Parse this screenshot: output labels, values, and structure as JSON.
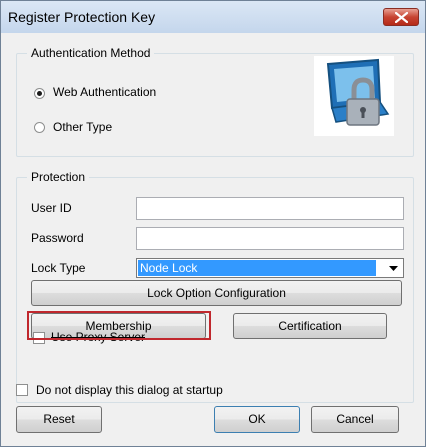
{
  "window": {
    "title": "Register Protection Key",
    "close_label": "close"
  },
  "auth": {
    "legend": "Authentication Method",
    "web_label": "Web Authentication",
    "other_label": "Other Type",
    "selected": "Web Authentication"
  },
  "protection": {
    "legend": "Protection",
    "user_id_label": "User ID",
    "user_id_value": "",
    "password_label": "Password",
    "password_value": "",
    "lock_type_label": "Lock Type",
    "lock_type_value": "Node Lock",
    "lock_option_button": "Lock Option Configuration",
    "membership_button": "Membership",
    "certification_button": "Certification",
    "proxy_label": "Use Proxy Server"
  },
  "footer": {
    "startup_label": "Do not display this dialog at startup",
    "reset_button": "Reset",
    "ok_button": "OK",
    "cancel_button": "Cancel"
  },
  "colors": {
    "highlight": "#c0272d",
    "selection": "#3399ff",
    "close": "#c74432"
  },
  "icons": {
    "logo": "laptop-lock-icon",
    "close": "close-icon",
    "dropdown": "chevron-down-icon"
  }
}
